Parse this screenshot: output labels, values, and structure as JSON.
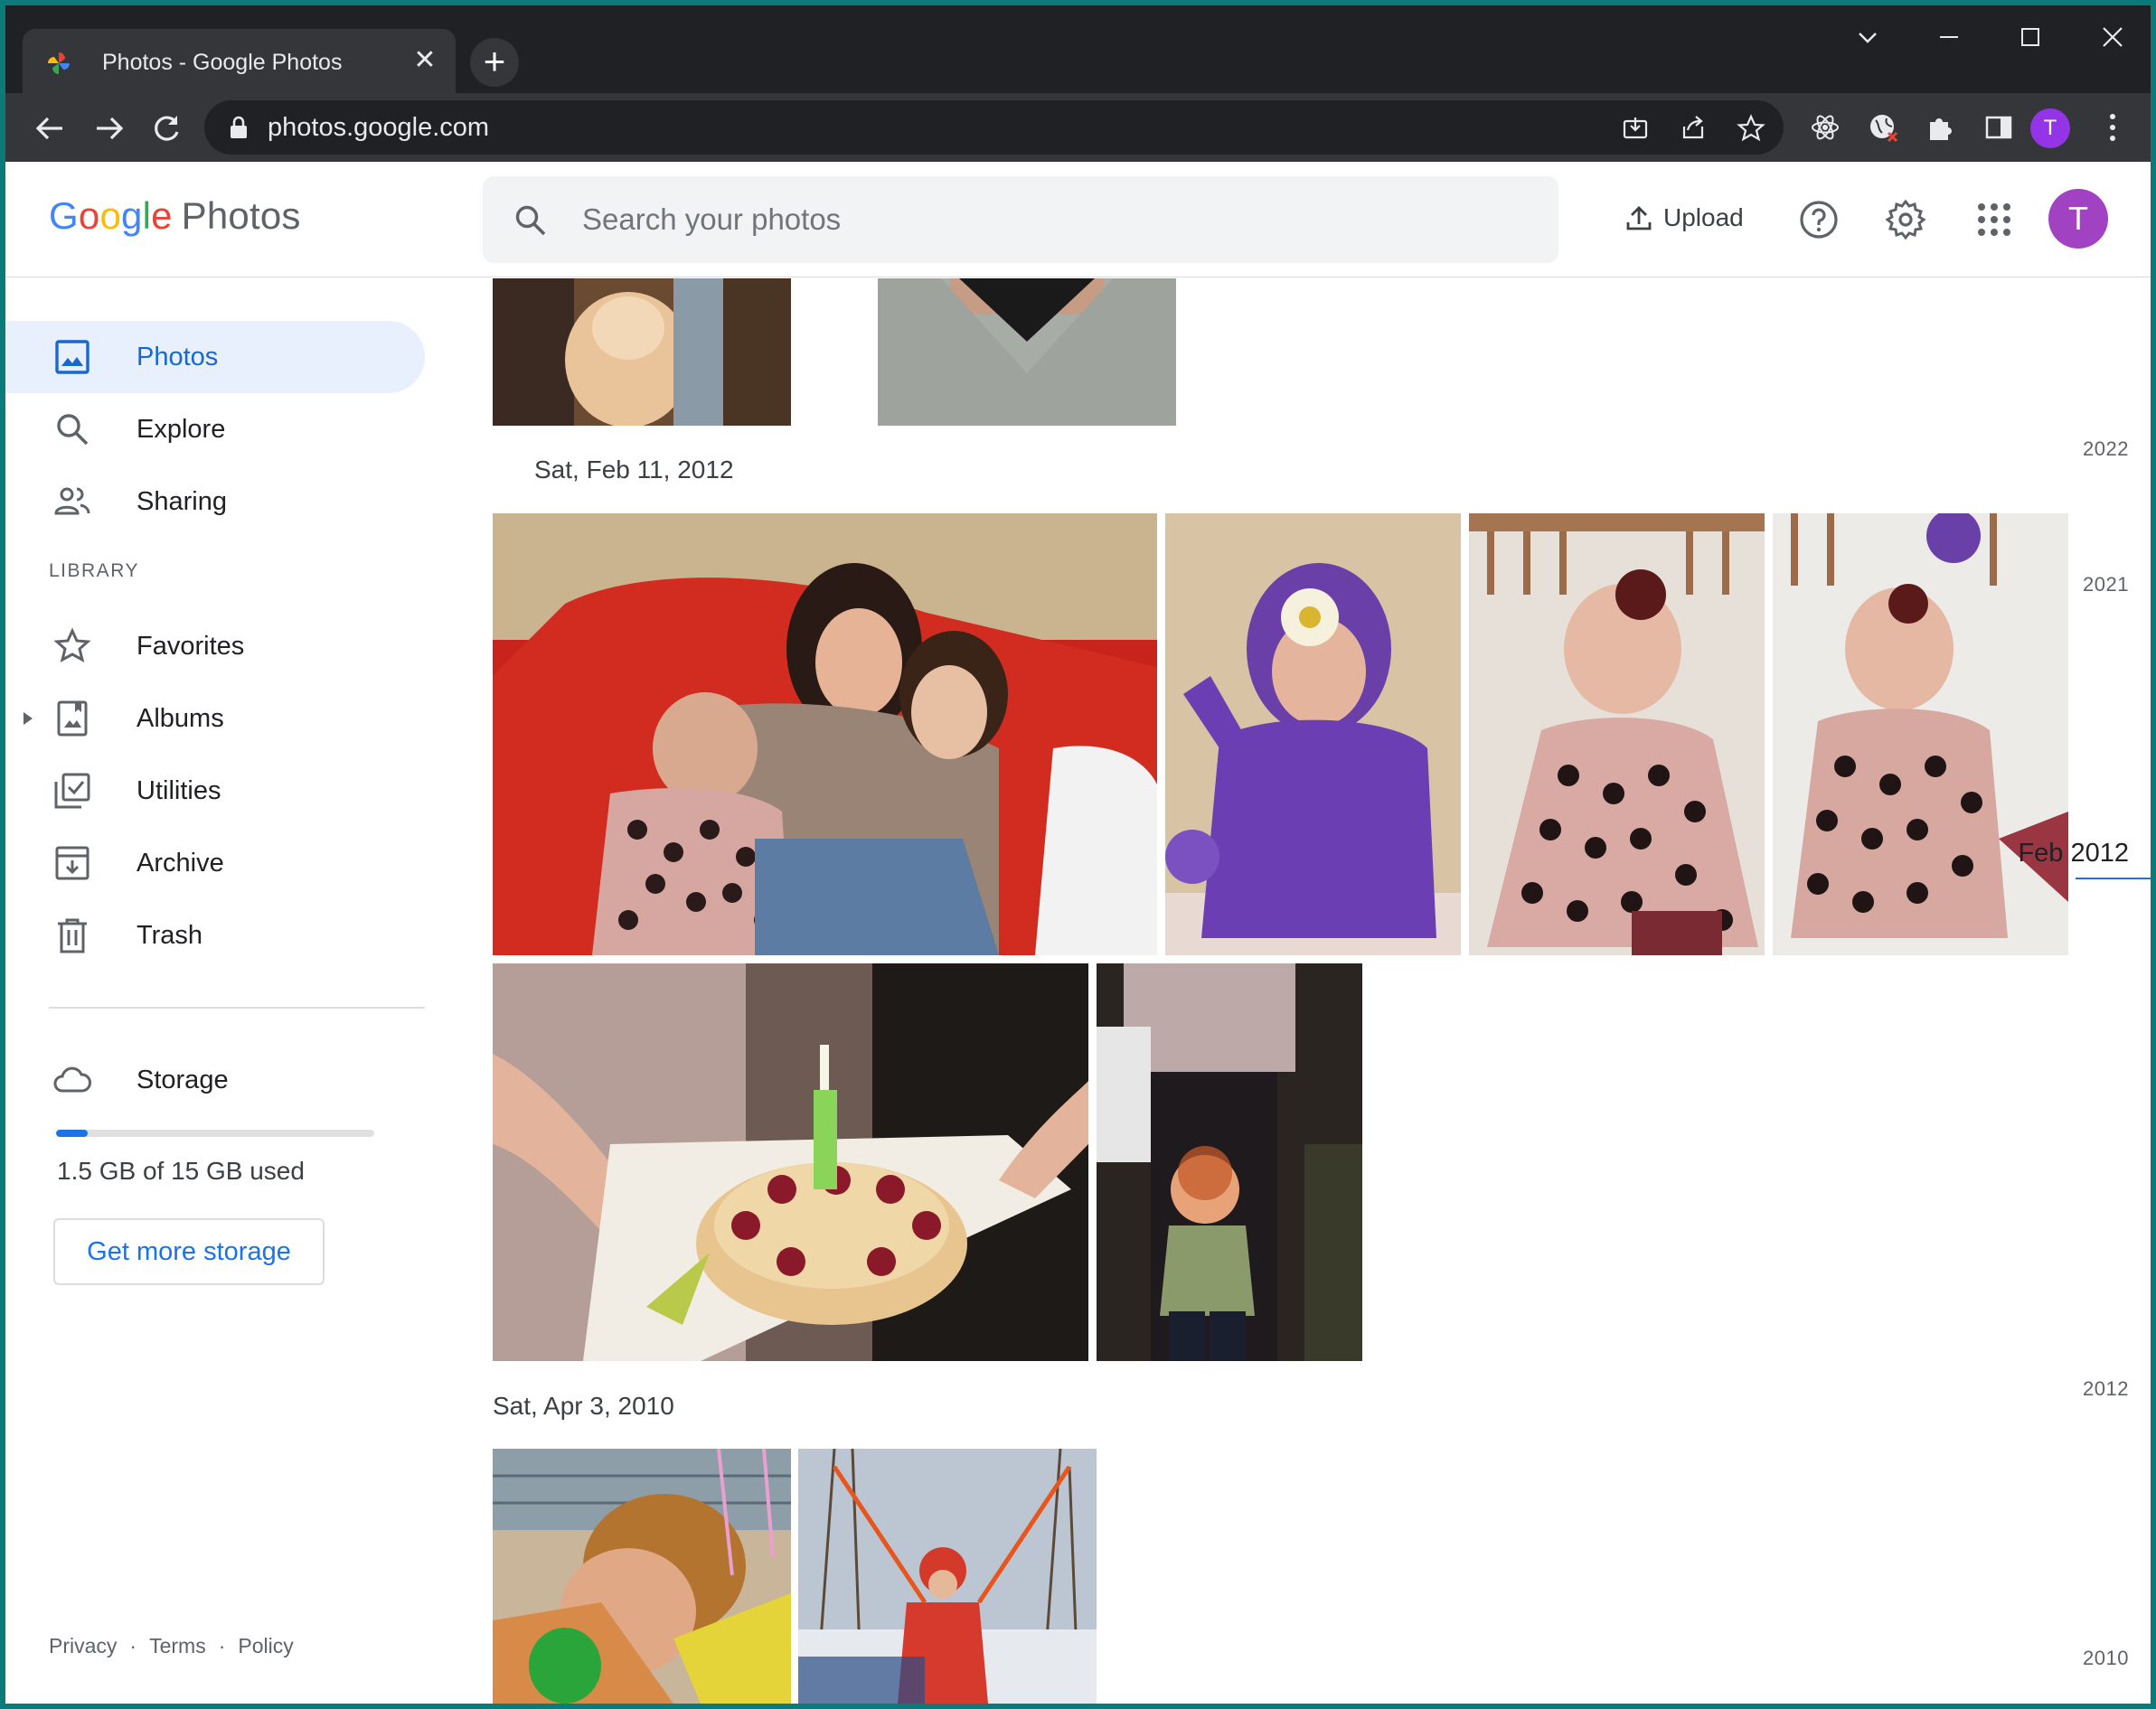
{
  "browser": {
    "tab_title": "Photos - Google Photos",
    "url": "photos.google.com",
    "profile_initial": "T"
  },
  "app": {
    "logo": {
      "g1": "G",
      "o1": "o",
      "o2": "o",
      "g2": "g",
      "l": "l",
      "e": "e",
      "product": "Photos"
    },
    "search_placeholder": "Search your photos",
    "upload_label": "Upload",
    "avatar_initial": "T",
    "avatar_color": "#a142c2"
  },
  "sidebar": {
    "items": [
      {
        "label": "Photos",
        "icon": "photo-icon",
        "active": true
      },
      {
        "label": "Explore",
        "icon": "search-icon"
      },
      {
        "label": "Sharing",
        "icon": "people-icon"
      }
    ],
    "library_heading": "LIBRARY",
    "library": [
      {
        "label": "Favorites",
        "icon": "star-icon"
      },
      {
        "label": "Albums",
        "icon": "album-icon"
      },
      {
        "label": "Utilities",
        "icon": "utilities-icon"
      },
      {
        "label": "Archive",
        "icon": "archive-icon"
      },
      {
        "label": "Trash",
        "icon": "trash-icon"
      }
    ],
    "storage": {
      "label": "Storage",
      "used_text": "1.5 GB of 15 GB used",
      "used_fraction": 0.1,
      "button": "Get more storage"
    },
    "footer": [
      "Privacy",
      "·",
      "Terms",
      "·",
      "Policy"
    ]
  },
  "content": {
    "groups": [
      {
        "date": "Sat, Feb 11, 2012"
      },
      {
        "date": "Sat, Apr 3, 2010"
      }
    ]
  },
  "timeline": {
    "years": [
      "2022",
      "2021",
      "2012",
      "2010"
    ],
    "current": "Feb 2012"
  },
  "colors": {
    "accent": "#1a73e8",
    "active_bg": "#e8f0fe"
  }
}
